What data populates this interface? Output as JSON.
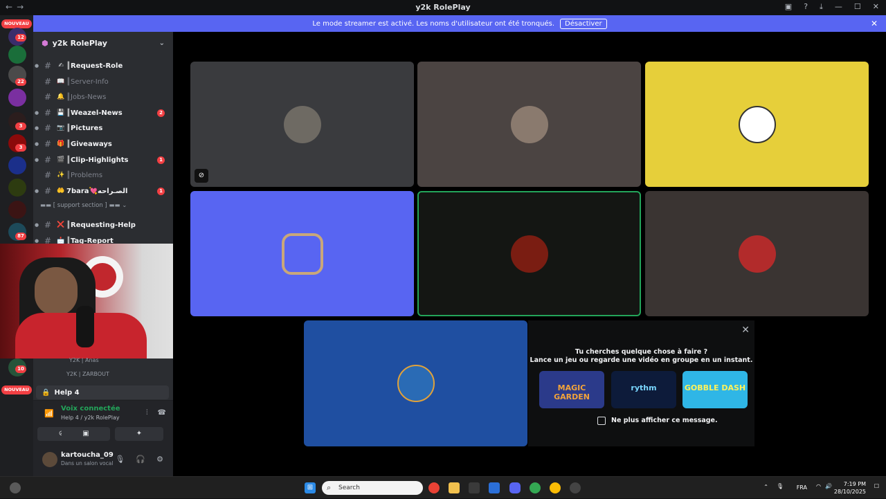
{
  "window": {
    "title": "y2k RolePlay",
    "nav_back": "←",
    "nav_forward": "→"
  },
  "banner": {
    "message": "Le mode streamer est activé. Les noms d'utilisateur ont été tronqués.",
    "button": "Désactiver",
    "close": "✕"
  },
  "server_rail": {
    "badges": [
      "12",
      "22",
      "3",
      "3",
      "87",
      "10"
    ],
    "nouveau_label": "NOUVEAU"
  },
  "guild": {
    "name": "y2k RolePlay",
    "chevron": "⌄"
  },
  "channels": [
    {
      "emoji": "✍",
      "name": "║Request-Role",
      "unread": true,
      "badge": ""
    },
    {
      "emoji": "📖",
      "name": "║Server-Info",
      "unread": false,
      "badge": ""
    },
    {
      "emoji": "🔔",
      "name": "║Jobs-News",
      "unread": false,
      "badge": ""
    },
    {
      "emoji": "💾",
      "name": "║Weazel-News",
      "unread": true,
      "badge": "2"
    },
    {
      "emoji": "📷",
      "name": "║Pictures",
      "unread": true,
      "badge": ""
    },
    {
      "emoji": "🎁",
      "name": "║Giveaways",
      "unread": true,
      "badge": ""
    },
    {
      "emoji": "🎬",
      "name": "║Clip-Highlights",
      "unread": true,
      "badge": "1"
    },
    {
      "emoji": "✨",
      "name": "║Problems",
      "unread": false,
      "badge": ""
    },
    {
      "emoji": "🤲",
      "name": "7bara💘الصـراحه",
      "unread": true,
      "badge": "1"
    }
  ],
  "section": {
    "label": "▬▬ [ support section ] ▬▬ ⌄"
  },
  "support_channels": [
    {
      "emoji": "❌",
      "name": "║Requesting-Help",
      "unread": true
    },
    {
      "emoji": "📩",
      "name": "║Tag-Report",
      "unread": true
    }
  ],
  "voice_members": [
    "Y2K | Anas",
    "Y2K | ZARBOUT"
  ],
  "voice_room": {
    "name": "Help 4"
  },
  "voice_connection": {
    "status": "Voix connectée",
    "location": "Help 4 / y2k RolePlay"
  },
  "user": {
    "name": "kartoucha_09",
    "status": "Dans un salon vocal"
  },
  "suggestion": {
    "line1": "Tu cherches quelque chose à faire ?",
    "line2": "Lance un jeu ou regarde une vidéo en groupe en un instant.",
    "activities": [
      "MAGIC GARDEN",
      "rythm",
      "GOBBLE DASH"
    ],
    "checkbox_label": "Ne plus afficher ce message."
  },
  "taskbar": {
    "search_placeholder": "Search",
    "lang": "FRA",
    "time": "7:19 PM",
    "date": "28/10/2025"
  },
  "colors": {
    "accent": "#5865f2",
    "banner": "#5865f2",
    "speaking": "#23a55a",
    "tile_yellow": "#e6cf3a",
    "tile_blue": "#5865f2",
    "tile_darkblue": "#1f4fa1"
  }
}
